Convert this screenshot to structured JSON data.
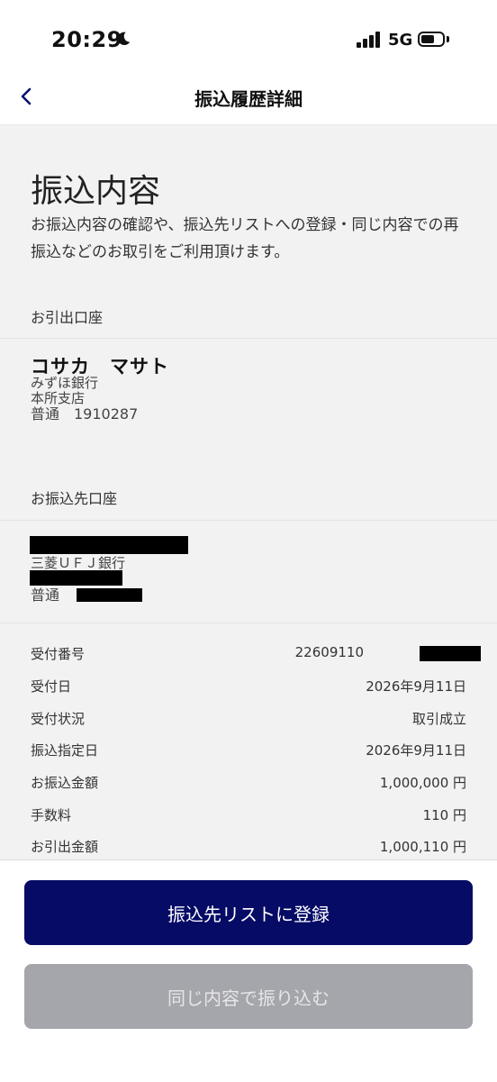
{
  "status_bar": {
    "time": "20:29",
    "network": "5G"
  },
  "header": {
    "title": "振込履歴詳細"
  },
  "main": {
    "heading": "振込内容",
    "description": "お振込内容の確認や、振込先リストへの登録・同じ内容での再振込などのお取引をご利用頂けます。",
    "source_label": "お引出口座",
    "source_account": {
      "name": "コサカ　マサト",
      "bank": "みずほ銀行",
      "branch": "本所支店",
      "type_number": "普通　1910287"
    },
    "dest_label": "お振込先口座",
    "dest_account": {
      "bank": "三菱ＵＦＪ銀行",
      "type": "普通"
    },
    "details": [
      {
        "label": "受付番号",
        "value": "22609110"
      },
      {
        "label": "受付日",
        "value": "2026年9月11日"
      },
      {
        "label": "受付状況",
        "value": "取引成立"
      },
      {
        "label": "振込指定日",
        "value": "2026年9月11日"
      },
      {
        "label": "お振込金額",
        "value": "1,000,000 円"
      },
      {
        "label": "手数料",
        "value": "110 円"
      },
      {
        "label": "お引出金額",
        "value": "1,000,110 円"
      }
    ]
  },
  "actions": {
    "register_label": "振込先リストに登録",
    "repeat_label": "同じ内容で振り込む"
  },
  "colors": {
    "primary": "#060b66",
    "disabled": "#a5a6ab",
    "background": "#f2f2f3"
  }
}
